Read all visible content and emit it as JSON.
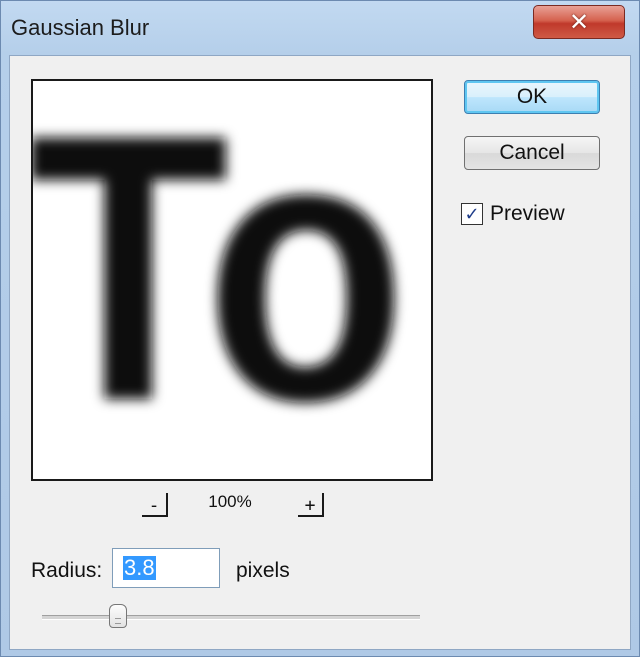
{
  "window": {
    "title": "Gaussian Blur",
    "close_icon": "close-x-icon",
    "close_glyph": "✕"
  },
  "buttons": {
    "ok_label": "OK",
    "cancel_label": "Cancel"
  },
  "preview_option": {
    "label": "Preview",
    "checked": true,
    "check_glyph": "✓"
  },
  "preview_image": {
    "text": "To",
    "zoom_out_label": "-",
    "zoom_in_label": "+",
    "zoom_level": "100%"
  },
  "radius": {
    "label": "Radius:",
    "value": "3.8",
    "units": "pixels"
  },
  "slider": {
    "min": 0.1,
    "max": 250,
    "fraction": 0.2
  },
  "colors": {
    "accent": "#3399ff",
    "close_button": "#c0392b",
    "ok_border": "#3c7fb1"
  }
}
